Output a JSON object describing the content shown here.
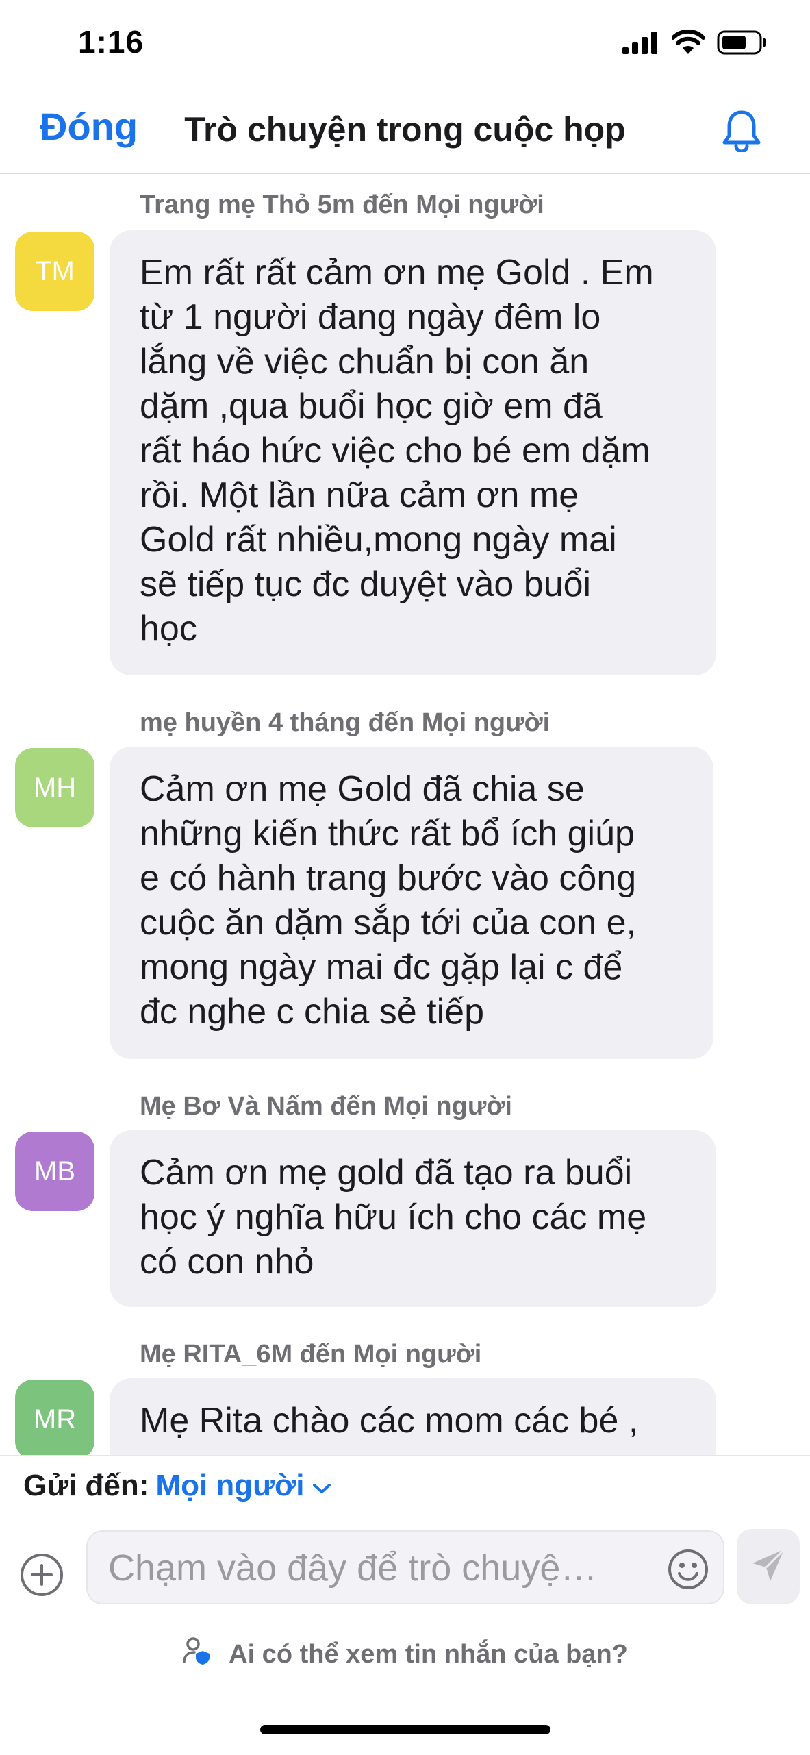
{
  "status_bar": {
    "time": "1:16"
  },
  "header": {
    "close_label": "Đóng",
    "title": "Trò chuyện trong cuộc họp",
    "bell_icon": "bell-icon"
  },
  "messages": [
    {
      "initials": "TM",
      "avatar_color": "#f4d93f",
      "sender": "Trang mẹ Thỏ 5m đến Mọi người",
      "text": "Em rất rất cảm ơn mẹ Gold . Em\ntừ 1 người đang ngày đêm lo\nlắng về việc chuẩn bị con ăn\ndặm ,qua buổi học giờ em đã\nrất háo hức việc cho bé em dặm\nrồi. Một lần nữa cảm ơn mẹ\nGold rất nhiều,mong ngày mai\nsẽ tiếp tục đc duyệt vào buổi\nhọc"
    },
    {
      "initials": "MH",
      "avatar_color": "#a9d77d",
      "sender": "mẹ huyền 4 tháng đến Mọi người",
      "text": "Cảm ơn mẹ Gold đã chia se\nnhững kiến thức rất bổ ích giúp\ne có hành trang bước vào công\ncuộc ăn dặm sắp tới của con e,\nmong ngày mai đc gặp lại c để\nđc nghe c chia sẻ tiếp"
    },
    {
      "initials": "MB",
      "avatar_color": "#b07ad0",
      "sender": "Mẹ Bơ Và Nấm đến Mọi người",
      "text": "Cảm ơn mẹ gold đã tạo ra buổi\nhọc ý nghĩa hữu ích cho các mẹ\ncó con nhỏ"
    },
    {
      "initials": "MR",
      "avatar_color": "#7cc47d",
      "sender": "Mẹ RITA_6M đến Mọi người",
      "text": "Mẹ Rita chào các mom các bé ,"
    }
  ],
  "composer": {
    "send_to_label": "Gửi đến:",
    "send_to_value": "Mọi người",
    "placeholder": "Chạm vào đây để trò chuyệ…",
    "privacy_text": "Ai có thể xem tin nhắn của bạn?"
  },
  "colors": {
    "accent": "#1a73e8",
    "bubble": "#efeff4",
    "secondary_text": "#6e6e73"
  }
}
